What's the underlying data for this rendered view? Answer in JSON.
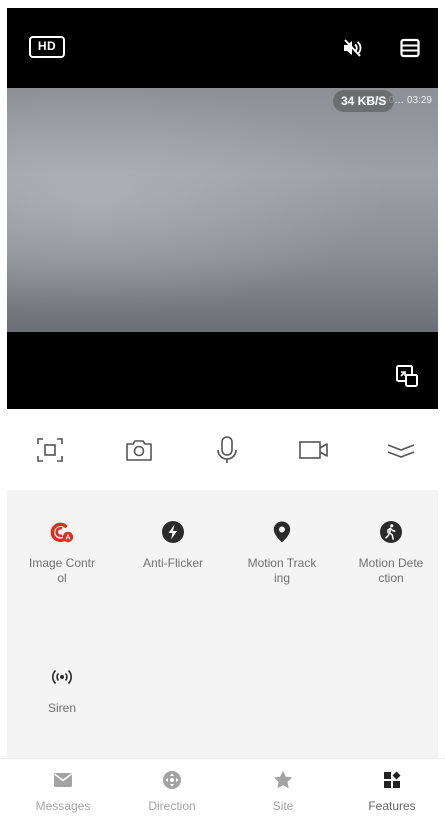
{
  "video": {
    "quality_badge": "HD",
    "timestamp": "2022-0… 03:29",
    "speed": "34 KB/S",
    "icons": {
      "mute": "speaker-muted-icon",
      "layout": "split-view-icon",
      "expand": "fullscreen-toggle-icon"
    }
  },
  "controls": {
    "items": [
      {
        "name": "screen-record-frame-icon"
      },
      {
        "name": "camera-snapshot-icon"
      },
      {
        "name": "microphone-icon"
      },
      {
        "name": "video-record-icon"
      },
      {
        "name": "collapse-chevrons-icon"
      }
    ]
  },
  "features": {
    "items": [
      {
        "label": "Image Control",
        "icon": "image-control-icon",
        "color": "#e02b20"
      },
      {
        "label": "Anti-Flicker",
        "icon": "lightning-icon",
        "color": "#2b2b2b"
      },
      {
        "label": "Motion Tracking",
        "icon": "location-pin-icon",
        "color": "#2b2b2b"
      },
      {
        "label": "Motion Detection",
        "icon": "walking-person-icon",
        "color": "#2b2b2b"
      },
      {
        "label": "Siren",
        "icon": "siren-icon",
        "color": "#2b2b2b"
      }
    ]
  },
  "nav": {
    "items": [
      {
        "label": "Messages",
        "icon": "envelope-icon"
      },
      {
        "label": "Direction",
        "icon": "direction-pad-icon"
      },
      {
        "label": "Site",
        "icon": "star-icon"
      },
      {
        "label": "Features",
        "icon": "grid-icon",
        "active": true
      }
    ]
  },
  "colors": {
    "accent": "#e02b20",
    "icon_dark": "#2b2b2b",
    "nav_inactive": "#a3a3a3"
  }
}
